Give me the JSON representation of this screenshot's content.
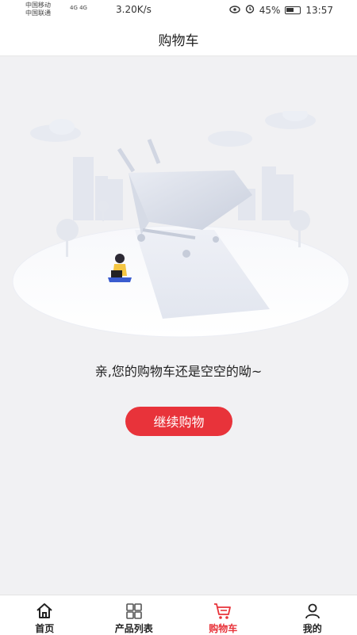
{
  "status_bar": {
    "carrier_1": "中国移动",
    "carrier_2": "中国联通",
    "network": "4G 4G",
    "speed": "3.20K/s",
    "battery": "45%",
    "time": "13:57"
  },
  "header": {
    "title": "购物车"
  },
  "empty_state": {
    "message": "亲,您的购物车还是空空的呦~",
    "button_label": "继续购物"
  },
  "tabs": [
    {
      "label": "首页",
      "icon": "home-icon",
      "active": false
    },
    {
      "label": "产品列表",
      "icon": "grid-icon",
      "active": false
    },
    {
      "label": "购物车",
      "icon": "cart-icon",
      "active": true
    },
    {
      "label": "我的",
      "icon": "user-icon",
      "active": false
    }
  ],
  "colors": {
    "accent": "#e8333a",
    "background": "#f1f1f3"
  }
}
